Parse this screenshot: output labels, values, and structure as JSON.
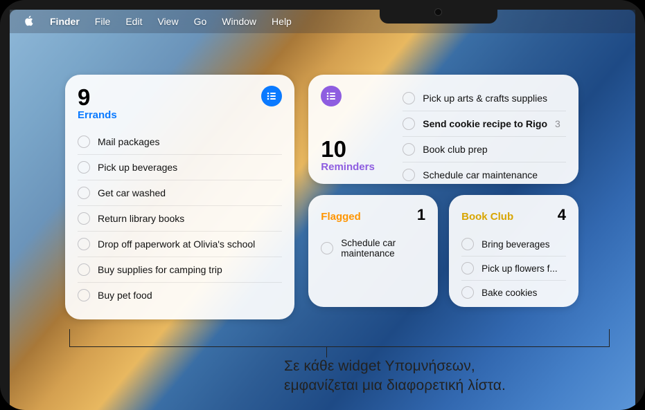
{
  "menubar": {
    "app": "Finder",
    "items": [
      "File",
      "Edit",
      "View",
      "Go",
      "Window",
      "Help"
    ]
  },
  "widgets": {
    "errands": {
      "count": "9",
      "title": "Errands",
      "accent": "#0a7aff",
      "items": [
        "Mail packages",
        "Pick up beverages",
        "Get car washed",
        "Return library books",
        "Drop off paperwork at Olivia's school",
        "Buy supplies for camping trip",
        "Buy pet food"
      ]
    },
    "reminders_all": {
      "count": "10",
      "title": "Reminders",
      "accent": "#8e5de0",
      "items": [
        {
          "text": "Pick up arts & crafts supplies",
          "bold": false
        },
        {
          "text": "Send cookie recipe to Rigo",
          "bold": true,
          "badge": "3"
        },
        {
          "text": "Book club prep",
          "bold": false
        },
        {
          "text": "Schedule car maintenance",
          "bold": false
        }
      ]
    },
    "flagged": {
      "title": "Flagged",
      "count": "1",
      "accent": "#ff9500",
      "items": [
        "Schedule car maintenance"
      ]
    },
    "bookclub": {
      "title": "Book Club",
      "count": "4",
      "accent": "#d8a500",
      "items": [
        "Bring beverages",
        "Pick up flowers f...",
        "Bake cookies"
      ]
    }
  },
  "caption_line1": "Σε κάθε widget Υπομνήσεων,",
  "caption_line2": "εμφανίζεται μια διαφορετική λίστα."
}
